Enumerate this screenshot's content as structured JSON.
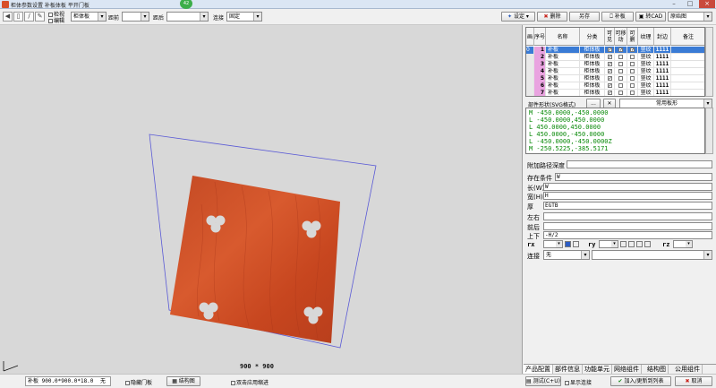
{
  "window": {
    "title": "柜体参数设置 补板体板 平开门板",
    "badge": "42",
    "controls": [
      "–",
      "□",
      "×"
    ]
  },
  "toolbar": {
    "checks": [
      "检视",
      "编辑"
    ],
    "category_combo": "柜体板",
    "front_label": "距前",
    "front_value": "",
    "back_label": "距后",
    "back_value": "",
    "connect_label": "连接",
    "connect_value": "固定",
    "buttons": {
      "settings": "设定",
      "delete": "删除",
      "save_as": "另存",
      "patch": "补板",
      "to_cad": "转CAD",
      "view": "原始图"
    }
  },
  "viewport": {
    "dimension": "900 * 900",
    "board_color": "#d1512a"
  },
  "statusbar": {
    "part_info": "补板 900.0*900.0*18.0",
    "part_status": "无",
    "hide_door": "隐藏门板",
    "structure_button": "结构图",
    "double_click": "双击应用缩进",
    "test_button": "测试(C+U)",
    "show_connect": "显示连接",
    "add_update": "加入/更新到列表",
    "cancel": "取消"
  },
  "grid": {
    "columns": [
      "画",
      "序号",
      "名称",
      "分类",
      "可见",
      "可移动",
      "可删",
      "纹理",
      "封边",
      "备注"
    ],
    "rows": [
      {
        "num": "1",
        "name": "补板",
        "category": "柜体板",
        "visible": true,
        "movable": true,
        "deletable": true,
        "grain": "竖纹",
        "edge": "1111",
        "note": "",
        "selected": true,
        "mark": "0"
      },
      {
        "num": "2",
        "name": "补板",
        "category": "柜体板",
        "visible": true,
        "movable": false,
        "deletable": false,
        "grain": "竖纹",
        "edge": "1111",
        "note": "",
        "selected": false,
        "mark": ""
      },
      {
        "num": "3",
        "name": "补板",
        "category": "柜体板",
        "visible": true,
        "movable": false,
        "deletable": false,
        "grain": "竖纹",
        "edge": "1111",
        "note": "",
        "selected": false,
        "mark": ""
      },
      {
        "num": "4",
        "name": "补板",
        "category": "柜体板",
        "visible": true,
        "movable": false,
        "deletable": false,
        "grain": "竖纹",
        "edge": "1111",
        "note": "",
        "selected": false,
        "mark": ""
      },
      {
        "num": "5",
        "name": "补板",
        "category": "柜体板",
        "visible": true,
        "movable": false,
        "deletable": false,
        "grain": "竖纹",
        "edge": "1111",
        "note": "",
        "selected": false,
        "mark": ""
      },
      {
        "num": "6",
        "name": "补板",
        "category": "柜体板",
        "visible": true,
        "movable": false,
        "deletable": false,
        "grain": "竖纹",
        "edge": "1111",
        "note": "",
        "selected": false,
        "mark": ""
      },
      {
        "num": "7",
        "name": "补板",
        "category": "柜体板",
        "visible": true,
        "movable": false,
        "deletable": false,
        "grain": "竖纹",
        "edge": "1111",
        "note": "",
        "selected": false,
        "mark": ""
      }
    ]
  },
  "shape": {
    "label": "部件形状(SVG格式)",
    "dots": "...",
    "common_button": "常用板形",
    "lines": [
      "M -450.0000,-450.0000",
      "L -450.0000,450.0000",
      "L 450.0000,450.0000",
      "L 450.0000,-450.0000",
      "L -450.0000,-450.0000Z",
      "M -250.5225,-385.5171"
    ]
  },
  "props": {
    "extra_depth_label": "附加路径深度",
    "condition_label": "存在条件",
    "condition_value": "W",
    "length_label": "长(W)",
    "length_value": "W",
    "width_label": "宽(H)",
    "width_value": "H",
    "thickness_label": "厚",
    "thickness_value": "EGTB",
    "lr_label": "左右",
    "lr_value": "",
    "fb_label": "前后",
    "fb_value": "",
    "ud_label": "上下",
    "ud_value": "-H/2",
    "rx_label": "rx",
    "ry_label": "ry",
    "rz_label": "rz",
    "connect_label": "连接",
    "connect_value": "无"
  },
  "tabs": [
    "产品配置",
    "部件信息",
    "功能单元",
    "网络组件",
    "结构图",
    "公用组件"
  ]
}
